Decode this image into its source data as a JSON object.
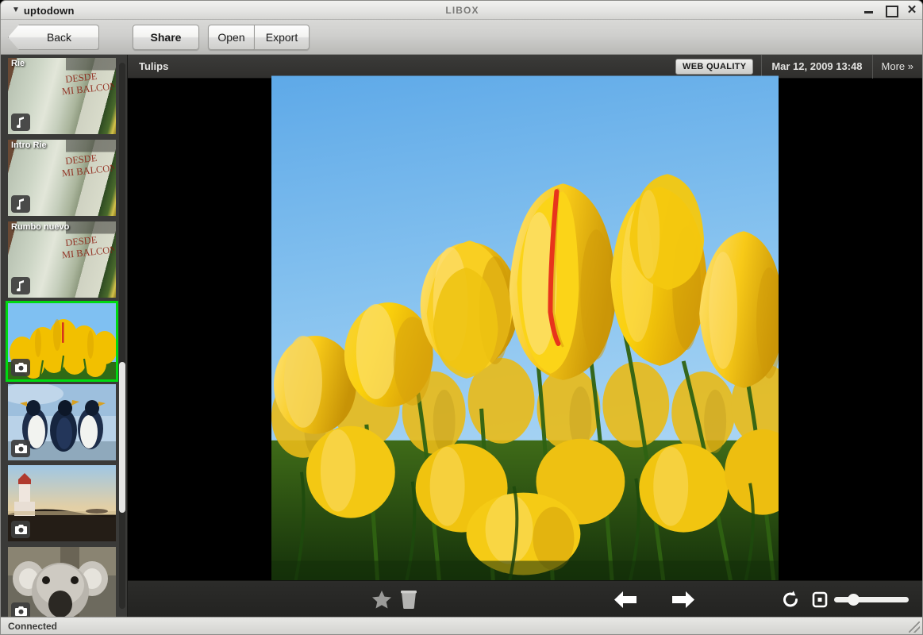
{
  "window": {
    "account_name": "uptodown",
    "account_chevron": "chevron-down-icon",
    "title": "LIBOX",
    "controls": {
      "minimize": "minimize-icon",
      "maximize": "maximize-icon",
      "close": "close-icon"
    }
  },
  "toolbar": {
    "back_label": "Back",
    "share_label": "Share",
    "open_label": "Open",
    "export_label": "Export"
  },
  "sidebar": {
    "items": [
      {
        "label": "Rie",
        "kind": "audio",
        "icon": "music-note-icon",
        "selected": false
      },
      {
        "label": "Intro Rie",
        "kind": "audio",
        "icon": "music-note-icon",
        "selected": false
      },
      {
        "label": "Rumbo nuevo",
        "kind": "audio",
        "icon": "music-note-icon",
        "selected": false
      },
      {
        "label": "",
        "kind": "photo-tulips",
        "icon": "camera-icon",
        "selected": true
      },
      {
        "label": "",
        "kind": "photo-penguins",
        "icon": "camera-icon",
        "selected": false
      },
      {
        "label": "",
        "kind": "photo-lighthouse",
        "icon": "camera-icon",
        "selected": false
      },
      {
        "label": "",
        "kind": "photo-koala",
        "icon": "camera-icon",
        "selected": false
      }
    ],
    "scrollbar": "vertical-scrollbar"
  },
  "viewer": {
    "photo_title": "Tulips",
    "quality_badge": "WEB QUALITY",
    "photo_date": "Mar 12, 2009 13:48",
    "more_label": "More »",
    "photo_subject": "yellow tulips against blue sky"
  },
  "bottom_toolbar": {
    "favorite": "star-icon",
    "delete": "trash-icon",
    "previous": "arrow-left-icon",
    "next": "arrow-right-icon",
    "rotate": "rotate-icon",
    "fit": "fit-to-screen-icon",
    "fullscreen": "split-contrast-icon",
    "zoom_value": 22
  },
  "statusbar": {
    "text": "Connected"
  },
  "colors": {
    "selection_green": "#00d911",
    "sky_blue": "#86bff0",
    "tulip_yellow": "#f5c400",
    "accent_red": "#e8341c",
    "chrome_gray": "#d2d2cf",
    "viewer_dark": "#2c2c2a"
  }
}
